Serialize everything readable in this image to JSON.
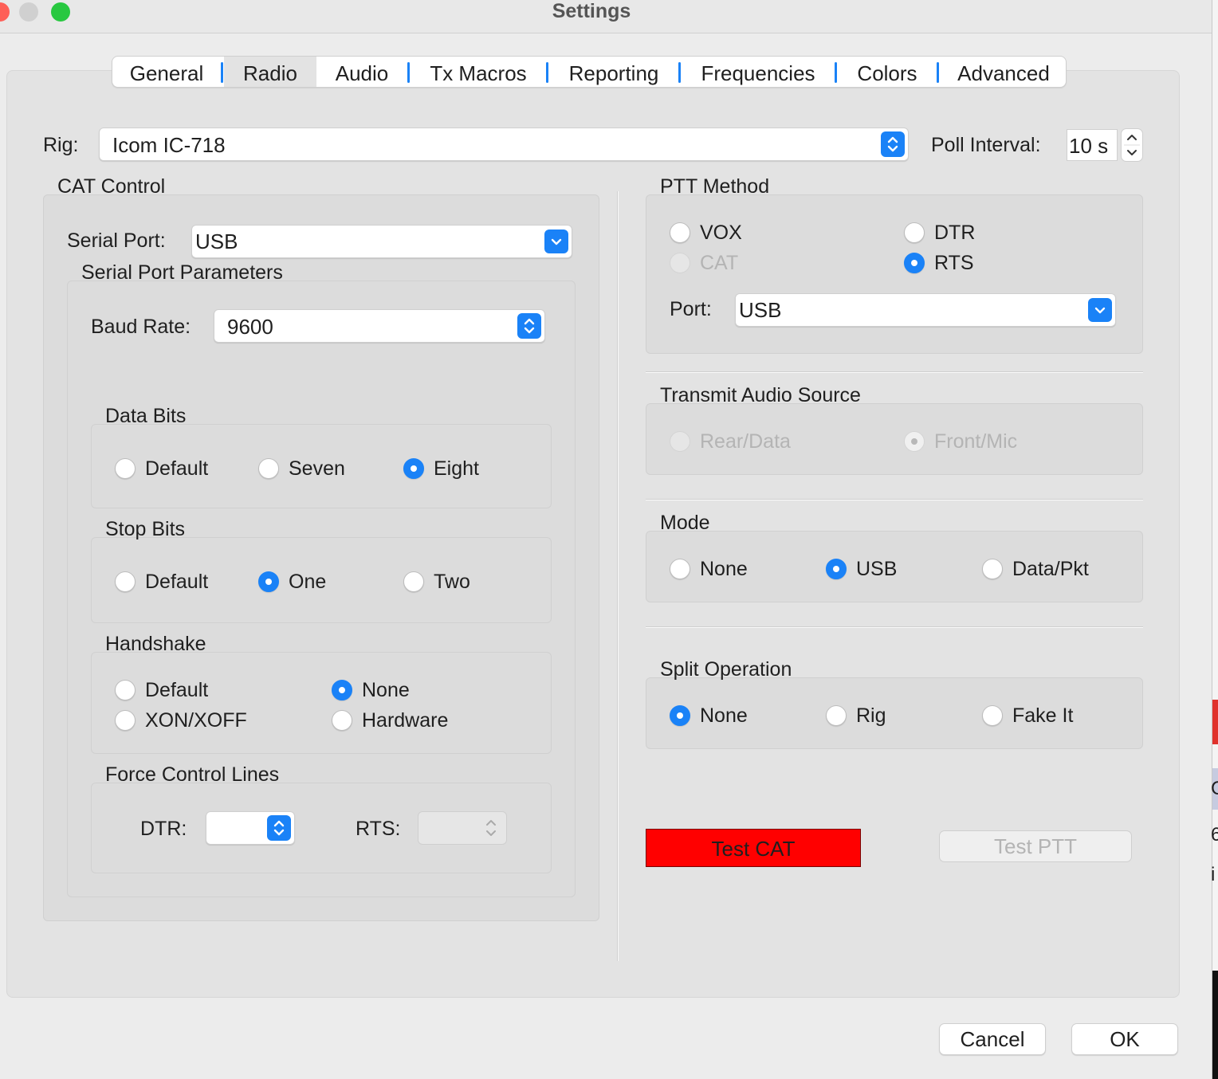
{
  "window": {
    "title": "Settings",
    "colors": {
      "close": "#fe5f57",
      "minimize": "#d0d0d0",
      "zoom": "#28c840"
    }
  },
  "tabs": [
    {
      "label": "General"
    },
    {
      "label": "Radio",
      "selected": true
    },
    {
      "label": "Audio"
    },
    {
      "label": "Tx Macros"
    },
    {
      "label": "Reporting"
    },
    {
      "label": "Frequencies"
    },
    {
      "label": "Colors"
    },
    {
      "label": "Advanced"
    }
  ],
  "rig": {
    "label": "Rig:",
    "value": "Icom IC-718",
    "poll_label": "Poll Interval:",
    "poll_value": "10 s"
  },
  "cat_control": {
    "title": "CAT Control",
    "serial_port_label": "Serial Port:",
    "serial_port_value": "USB",
    "params_title": "Serial Port Parameters",
    "baud_label": "Baud Rate:",
    "baud_value": "9600",
    "data_bits": {
      "title": "Data Bits",
      "options": [
        "Default",
        "Seven",
        "Eight"
      ],
      "selected": "Eight"
    },
    "stop_bits": {
      "title": "Stop Bits",
      "options": [
        "Default",
        "One",
        "Two"
      ],
      "selected": "One"
    },
    "handshake": {
      "title": "Handshake",
      "options": [
        "Default",
        "None",
        "XON/XOFF",
        "Hardware"
      ],
      "selected": "None"
    },
    "force_lines": {
      "title": "Force Control Lines",
      "dtr_label": "DTR:",
      "dtr_value": "",
      "rts_label": "RTS:",
      "rts_value": ""
    }
  },
  "ptt": {
    "title": "PTT Method",
    "options": [
      "VOX",
      "DTR",
      "CAT",
      "RTS"
    ],
    "selected": "RTS",
    "disabled": [
      "CAT"
    ],
    "port_label": "Port:",
    "port_value": "USB"
  },
  "tx_audio": {
    "title": "Transmit Audio Source",
    "options": [
      "Rear/Data",
      "Front/Mic"
    ],
    "selected": "Front/Mic",
    "disabled": true
  },
  "mode": {
    "title": "Mode",
    "options": [
      "None",
      "USB",
      "Data/Pkt"
    ],
    "selected": "USB"
  },
  "split": {
    "title": "Split Operation",
    "options": [
      "None",
      "Rig",
      "Fake It"
    ],
    "selected": "None"
  },
  "buttons": {
    "test_cat": "Test CAT",
    "test_ptt": "Test PTT",
    "cancel": "Cancel",
    "ok": "OK"
  },
  "background_fragments": [
    "C",
    "6",
    "i"
  ],
  "accent_color": "#1a82f7",
  "test_cat_color": "#ff0000"
}
